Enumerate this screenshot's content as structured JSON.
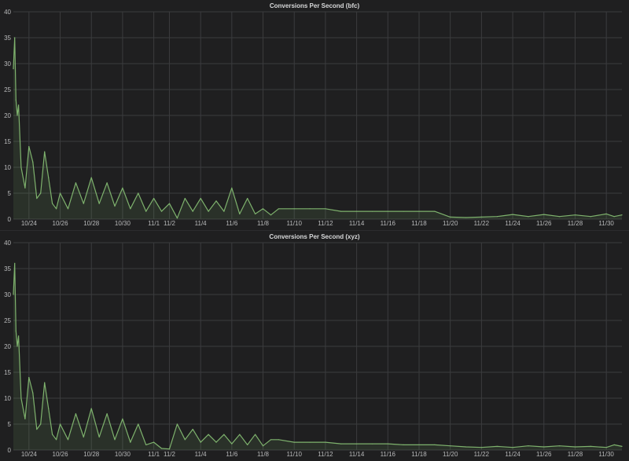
{
  "panels": [
    {
      "title": "Conversions Per Second (bfc)"
    },
    {
      "title": "Conversions Per Second (xyz)"
    }
  ],
  "colors": {
    "line": "#7eb26d",
    "fill": "rgba(126,178,109,0.12)",
    "grid": "#3b3c3e",
    "text": "#b8b9ba",
    "background": "#1f1f20"
  },
  "chart_data": [
    {
      "type": "area",
      "title": "Conversions Per Second (bfc)",
      "xlabel": "",
      "ylabel": "",
      "x_tick_labels": [
        "10/24",
        "10/26",
        "10/28",
        "10/30",
        "11/1",
        "11/2",
        "11/4",
        "11/6",
        "11/8",
        "11/10",
        "11/12",
        "11/14",
        "11/16",
        "11/18",
        "11/20",
        "11/22",
        "11/24",
        "11/26",
        "11/28",
        "11/30"
      ],
      "y_ticks": [
        0,
        5,
        10,
        15,
        20,
        25,
        30,
        35,
        40
      ],
      "ylim": [
        0,
        40
      ],
      "xlim": [
        "10/23",
        "12/01"
      ],
      "grid": true,
      "series": [
        {
          "points": [
            [
              "10/23 00:00",
              29
            ],
            [
              "10/23 02:00",
              35
            ],
            [
              "10/23 04:00",
              23
            ],
            [
              "10/23 06:00",
              20
            ],
            [
              "10/23 08:00",
              22
            ],
            [
              "10/23 12:00",
              10
            ],
            [
              "10/23 18:00",
              6
            ],
            [
              "10/24 00:00",
              14
            ],
            [
              "10/24 06:00",
              11
            ],
            [
              "10/24 12:00",
              4
            ],
            [
              "10/24 18:00",
              5
            ],
            [
              "10/25 00:00",
              13
            ],
            [
              "10/25 06:00",
              8
            ],
            [
              "10/25 12:00",
              3
            ],
            [
              "10/25 18:00",
              2
            ],
            [
              "10/26 00:00",
              5
            ],
            [
              "10/26 12:00",
              2
            ],
            [
              "10/27 00:00",
              7
            ],
            [
              "10/27 12:00",
              3
            ],
            [
              "10/28 00:00",
              8
            ],
            [
              "10/28 12:00",
              3
            ],
            [
              "10/29 00:00",
              7
            ],
            [
              "10/29 12:00",
              2.5
            ],
            [
              "10/30 00:00",
              6
            ],
            [
              "10/30 12:00",
              2
            ],
            [
              "10/31 00:00",
              5
            ],
            [
              "10/31 12:00",
              1.5
            ],
            [
              "11/01 00:00",
              4
            ],
            [
              "11/01 12:00",
              1.5
            ],
            [
              "11/02 00:00",
              3
            ],
            [
              "11/02 12:00",
              0.2
            ],
            [
              "11/03 00:00",
              4
            ],
            [
              "11/03 12:00",
              1.5
            ],
            [
              "11/04 00:00",
              4
            ],
            [
              "11/04 12:00",
              1.5
            ],
            [
              "11/05 00:00",
              3.5
            ],
            [
              "11/05 12:00",
              1.5
            ],
            [
              "11/06 00:00",
              6
            ],
            [
              "11/06 12:00",
              1
            ],
            [
              "11/07 00:00",
              4
            ],
            [
              "11/07 12:00",
              1
            ],
            [
              "11/08 00:00",
              2
            ],
            [
              "11/08 12:00",
              0.8
            ],
            [
              "11/09 00:00",
              2
            ],
            [
              "11/10 00:00",
              2
            ],
            [
              "11/11 00:00",
              2
            ],
            [
              "11/12 00:00",
              2
            ],
            [
              "11/13 00:00",
              1.5
            ],
            [
              "11/14 00:00",
              1.5
            ],
            [
              "11/15 00:00",
              1.5
            ],
            [
              "11/16 00:00",
              1.5
            ],
            [
              "11/17 00:00",
              1.5
            ],
            [
              "11/18 00:00",
              1.5
            ],
            [
              "11/19 00:00",
              1.5
            ],
            [
              "11/20 00:00",
              0.4
            ],
            [
              "11/21 00:00",
              0.3
            ],
            [
              "11/22 00:00",
              0.4
            ],
            [
              "11/23 00:00",
              0.5
            ],
            [
              "11/24 00:00",
              0.9
            ],
            [
              "11/25 00:00",
              0.5
            ],
            [
              "11/26 00:00",
              0.9
            ],
            [
              "11/27 00:00",
              0.5
            ],
            [
              "11/28 00:00",
              0.8
            ],
            [
              "11/29 00:00",
              0.5
            ],
            [
              "11/30 00:00",
              1
            ],
            [
              "11/30 12:00",
              0.5
            ],
            [
              "12/01 00:00",
              0.8
            ]
          ]
        }
      ]
    },
    {
      "type": "area",
      "title": "Conversions Per Second (xyz)",
      "xlabel": "",
      "ylabel": "",
      "x_tick_labels": [
        "10/24",
        "10/26",
        "10/28",
        "10/30",
        "11/1",
        "11/2",
        "11/4",
        "11/6",
        "11/8",
        "11/10",
        "11/12",
        "11/14",
        "11/16",
        "11/18",
        "11/20",
        "11/22",
        "11/24",
        "11/26",
        "11/28",
        "11/30"
      ],
      "y_ticks": [
        0,
        5,
        10,
        15,
        20,
        25,
        30,
        35,
        40
      ],
      "ylim": [
        0,
        40
      ],
      "xlim": [
        "10/23",
        "12/01"
      ],
      "grid": true,
      "series": [
        {
          "points": [
            [
              "10/23 00:00",
              30
            ],
            [
              "10/23 02:00",
              36
            ],
            [
              "10/23 04:00",
              23
            ],
            [
              "10/23 06:00",
              20
            ],
            [
              "10/23 08:00",
              22
            ],
            [
              "10/23 12:00",
              10
            ],
            [
              "10/23 18:00",
              6
            ],
            [
              "10/24 00:00",
              14
            ],
            [
              "10/24 06:00",
              11
            ],
            [
              "10/24 12:00",
              4
            ],
            [
              "10/24 18:00",
              5
            ],
            [
              "10/25 00:00",
              13
            ],
            [
              "10/25 06:00",
              8
            ],
            [
              "10/25 12:00",
              3
            ],
            [
              "10/25 18:00",
              2
            ],
            [
              "10/26 00:00",
              5
            ],
            [
              "10/26 12:00",
              2
            ],
            [
              "10/27 00:00",
              7
            ],
            [
              "10/27 12:00",
              2.5
            ],
            [
              "10/28 00:00",
              8
            ],
            [
              "10/28 12:00",
              2.5
            ],
            [
              "10/29 00:00",
              7
            ],
            [
              "10/29 12:00",
              2
            ],
            [
              "10/30 00:00",
              6
            ],
            [
              "10/30 12:00",
              1.5
            ],
            [
              "10/31 00:00",
              5
            ],
            [
              "10/31 12:00",
              1
            ],
            [
              "11/01 00:00",
              1.5
            ],
            [
              "11/01 12:00",
              0.3
            ],
            [
              "11/02 00:00",
              0.2
            ],
            [
              "11/02 12:00",
              5
            ],
            [
              "11/03 00:00",
              2
            ],
            [
              "11/03 12:00",
              4
            ],
            [
              "11/04 00:00",
              1.5
            ],
            [
              "11/04 12:00",
              3
            ],
            [
              "11/05 00:00",
              1.5
            ],
            [
              "11/05 12:00",
              3
            ],
            [
              "11/06 00:00",
              1.2
            ],
            [
              "11/06 12:00",
              3
            ],
            [
              "11/07 00:00",
              1
            ],
            [
              "11/07 12:00",
              3
            ],
            [
              "11/08 00:00",
              0.8
            ],
            [
              "11/08 12:00",
              2
            ],
            [
              "11/09 00:00",
              2
            ],
            [
              "11/10 00:00",
              1.5
            ],
            [
              "11/11 00:00",
              1.5
            ],
            [
              "11/12 00:00",
              1.5
            ],
            [
              "11/13 00:00",
              1.2
            ],
            [
              "11/14 00:00",
              1.2
            ],
            [
              "11/15 00:00",
              1.2
            ],
            [
              "11/16 00:00",
              1.2
            ],
            [
              "11/17 00:00",
              1
            ],
            [
              "11/18 00:00",
              1
            ],
            [
              "11/19 00:00",
              1
            ],
            [
              "11/20 00:00",
              0.8
            ],
            [
              "11/21 00:00",
              0.6
            ],
            [
              "11/22 00:00",
              0.5
            ],
            [
              "11/23 00:00",
              0.7
            ],
            [
              "11/24 00:00",
              0.5
            ],
            [
              "11/25 00:00",
              0.8
            ],
            [
              "11/26 00:00",
              0.6
            ],
            [
              "11/27 00:00",
              0.8
            ],
            [
              "11/28 00:00",
              0.6
            ],
            [
              "11/29 00:00",
              0.7
            ],
            [
              "11/30 00:00",
              0.5
            ],
            [
              "11/30 12:00",
              1
            ],
            [
              "12/01 00:00",
              0.7
            ]
          ]
        }
      ]
    }
  ]
}
